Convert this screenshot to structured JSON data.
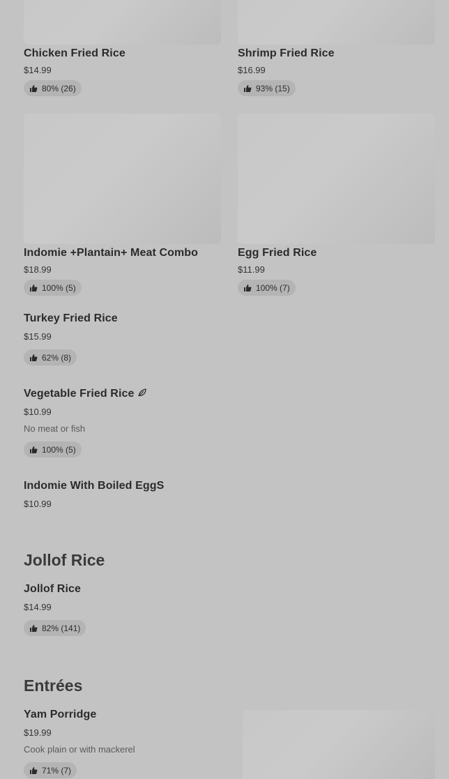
{
  "items": [
    {
      "name": "Chicken Fried Rice",
      "price": "$14.99",
      "rating": "80% (26)"
    },
    {
      "name": "Shrimp Fried Rice",
      "price": "$16.99",
      "rating": "93% (15)"
    },
    {
      "name": "Indomie +Plantain+ Meat Combo",
      "price": "$18.99",
      "rating": "100% (5)"
    },
    {
      "name": "Egg Fried Rice",
      "price": "$11.99",
      "rating": "100% (7)"
    },
    {
      "name": "Turkey Fried Rice",
      "price": "$15.99",
      "rating": "62% (8)"
    },
    {
      "name": "Vegetable Fried Rice",
      "price": "$10.99",
      "description": "No meat or fish",
      "rating": "100% (5)",
      "icon": "leaf-icon"
    },
    {
      "name": "Indomie With Boiled EggS",
      "price": "$10.99"
    }
  ],
  "sections": {
    "jollof": {
      "title": "Jollof Rice",
      "items": [
        {
          "name": "Jollof Rice",
          "price": "$14.99",
          "rating": "82% (141)"
        }
      ]
    },
    "entrees": {
      "title": "Entrées",
      "items": [
        {
          "name": "Yam Porridge",
          "price": "$19.99",
          "description": "Cook plain or with mackerel",
          "rating": "71% (7)"
        }
      ]
    }
  },
  "icons": {
    "rating": "thumbs-up-icon",
    "vegetarian": "leaf-icon"
  }
}
